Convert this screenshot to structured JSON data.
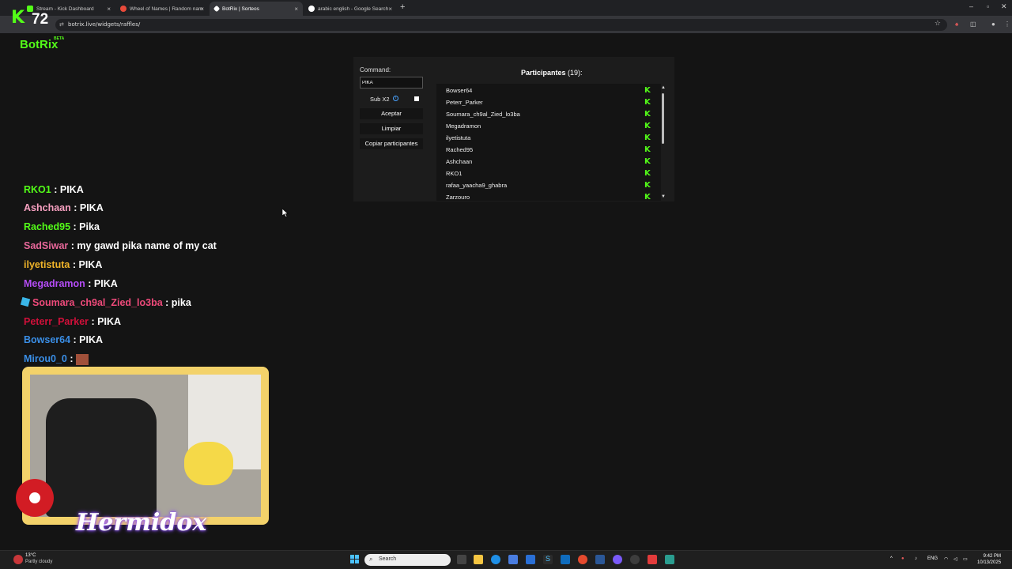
{
  "browser": {
    "tabs": [
      {
        "label": "Stream - Kick Dashboard",
        "active": false
      },
      {
        "label": "Wheel of Names | Random nam",
        "active": false
      },
      {
        "label": "BotRix | Sorteos",
        "active": true
      },
      {
        "label": "arabic english - Google Search",
        "active": false
      }
    ],
    "new_tab": "+",
    "url": "botrix.live/widgets/raffles/",
    "close_symbol": "×"
  },
  "overlay": {
    "viewer_count": "72"
  },
  "page": {
    "brand": "BotRix",
    "beta": "BETA"
  },
  "raffle": {
    "command_label": "Command:",
    "command_value": "PIKA",
    "sub_label": "Sub X2",
    "accept": "Aceptar",
    "clear": "Limpiar",
    "copy": "Copiar participantes",
    "participants_title": "Participantes",
    "participants_count": "(19):",
    "participants": [
      "Bowser64",
      "Peterr_Parker",
      "Soumara_ch9al_Zied_lo3ba",
      "Megadramon",
      "ilyetistuta",
      "Rached95",
      "Ashchaan",
      "RKO1",
      "rafaa_yaacha9_ghabra",
      "Zarzouro"
    ]
  },
  "chat": [
    {
      "user": "RKO1",
      "msg": ": PIKA",
      "color": "#53fc18"
    },
    {
      "user": "Ashchaan",
      "msg": ": PIKA",
      "color": "#f7a0c0"
    },
    {
      "user": "Rached95",
      "msg": ": Pika",
      "color": "#53fc18"
    },
    {
      "user": "SadSiwar",
      "msg": ": my gawd pika name of my cat",
      "color": "#e8679a"
    },
    {
      "user": "ilyetistuta",
      "msg": ": PIKA",
      "color": "#f0b429"
    },
    {
      "user": "Megadramon",
      "msg": ": PIKA",
      "color": "#b44cf5"
    },
    {
      "user": "Soumara_ch9al_Zied_lo3ba",
      "msg": ": pika",
      "color": "#ee4a7a"
    },
    {
      "user": "Peterr_Parker",
      "msg": ": PIKA",
      "color": "#d0103a"
    },
    {
      "user": "Bowser64",
      "msg": ": PIKA",
      "color": "#3a8ee6"
    },
    {
      "user": "Mirou0_0",
      "msg": ":",
      "color": "#3a8ee6"
    }
  ],
  "webcam": {
    "name": "Hermidox"
  },
  "taskbar": {
    "temp": "13°C",
    "condition": "Partly cloudy",
    "search": "Search",
    "lang": "ENG",
    "time": "9:42 PM",
    "date": "10/13/2025"
  },
  "colors": {
    "kick_green": "#53fc18",
    "panel_bg": "#1c1c1c",
    "list_bg": "#141414"
  }
}
